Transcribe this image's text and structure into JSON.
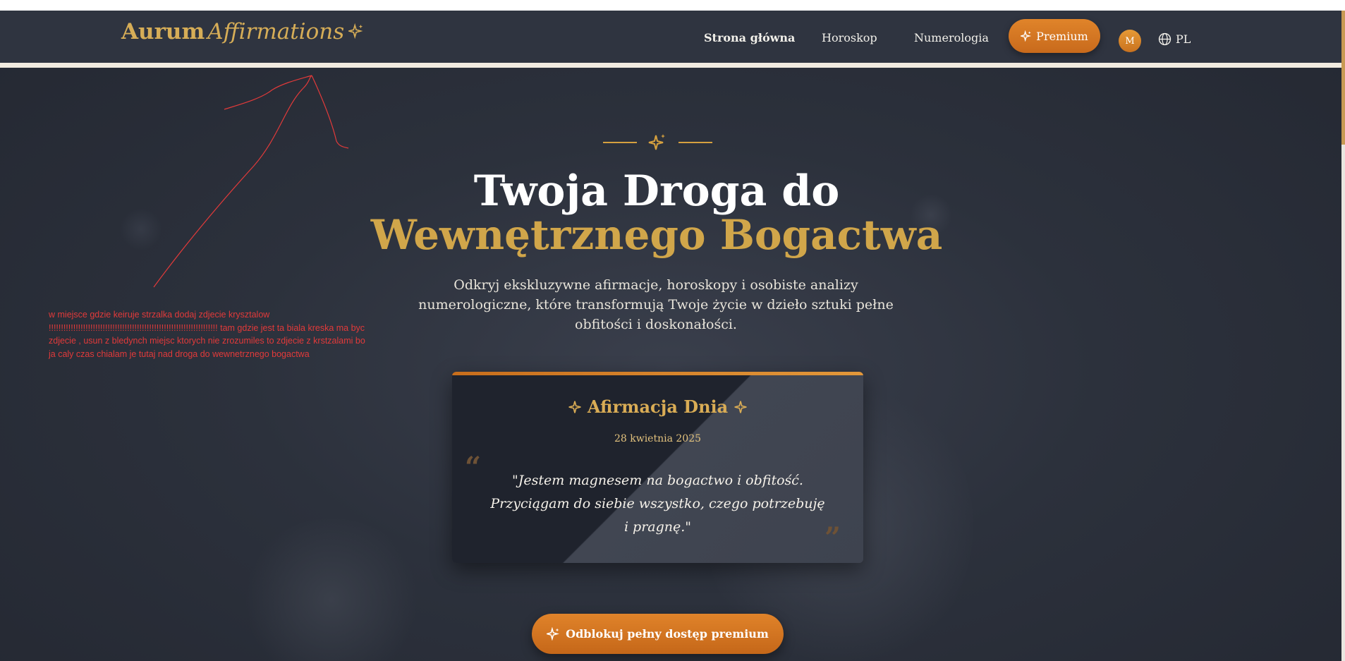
{
  "nav": {
    "logo_main": "Aurum",
    "logo_accent": "Affirmations",
    "links": [
      "Strona główna",
      "Horoskop",
      "Numerologia"
    ],
    "premium_label": "Premium",
    "avatar_initial": "M",
    "language": "PL"
  },
  "hero": {
    "title_line1": "Twoja Droga do",
    "title_line2": "Wewnętrznego Bogactwa",
    "subtitle": "Odkryj ekskluzywne afirmacje, horoskopy i osobiste analizy numerologiczne, które transformują Twoje życie w dzieło sztuki pełne obfitości i doskonałości."
  },
  "affirmation_card": {
    "title": "Afirmacja Dnia",
    "date": "28 kwietnia 2025",
    "quote": "\"Jestem magnesem na bogactwo i obfitość. Przyciągam do siebie wszystko, czego potrzebuję i pragnę.\""
  },
  "cta": {
    "label": "Odblokuj pełny dostęp premium"
  },
  "annotation": {
    "text": "w miejsce gdzie keiruje strzalka dodaj zdjecie krysztalow !!!!!!!!!!!!!!!!!!!!!!!!!!!!!!!!!!!!!!!!!!!!!!!!!!!!!!!!!!!!!!!!!!!!! tam gdzie jest ta biala kreska  ma byc zdjecie , usun z bledynch miejsc ktorych nie zrozumiles to zdjecie z krstzalami bo ja caly czas chialam je tutaj nad droga do wewnetrznego bogactwa"
  },
  "colors": {
    "gold": "#d1a64a",
    "orange": "#e0842a",
    "background": "#2c313c",
    "annotation_red": "#e23a3a"
  },
  "icons": [
    "sparkle-icon",
    "globe-icon",
    "quote-open-icon",
    "quote-close-icon"
  ]
}
